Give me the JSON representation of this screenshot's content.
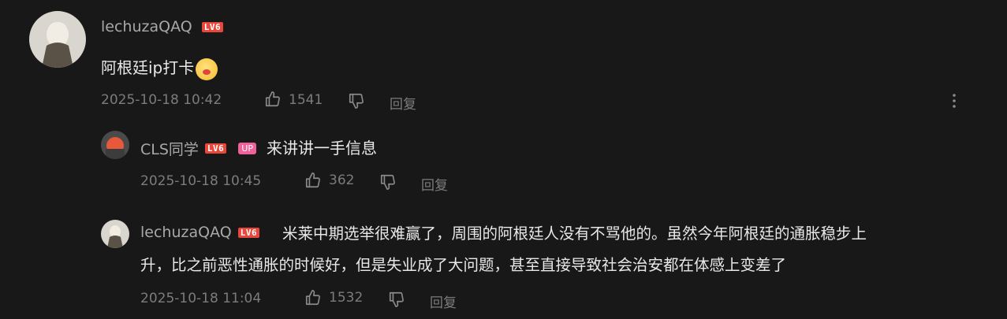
{
  "comments": [
    {
      "user": "lechuzaQAQ",
      "level": "LV6",
      "text": "阿根廷ip打卡",
      "emoji": "heart-hug-emoji",
      "time": "2025-10-18 10:42",
      "likes": "1541",
      "reply_label": "回复"
    },
    {
      "user": "CLS同学",
      "level": "LV6",
      "badge": "UP",
      "text": "来讲讲一手信息",
      "time": "2025-10-18 10:45",
      "likes": "362",
      "reply_label": "回复"
    },
    {
      "user": "lechuzaQAQ",
      "level": "LV6",
      "text_line1": "米莱中期选举很难赢了，周围的阿根廷人没有不骂他的。虽然今年阿根廷的通胀稳步上",
      "text_line2": "升，比之前恶性通胀的时候好，但是失业成了大问题，甚至直接导致社会治安都在体感上变差了",
      "time": "2025-10-18 11:04",
      "likes": "1532",
      "reply_label": "回复"
    }
  ],
  "colors": {
    "background": "#181818",
    "level_badge": "#e8483b",
    "up_badge": "#f0609a",
    "meta_text": "#7c7c7c"
  }
}
